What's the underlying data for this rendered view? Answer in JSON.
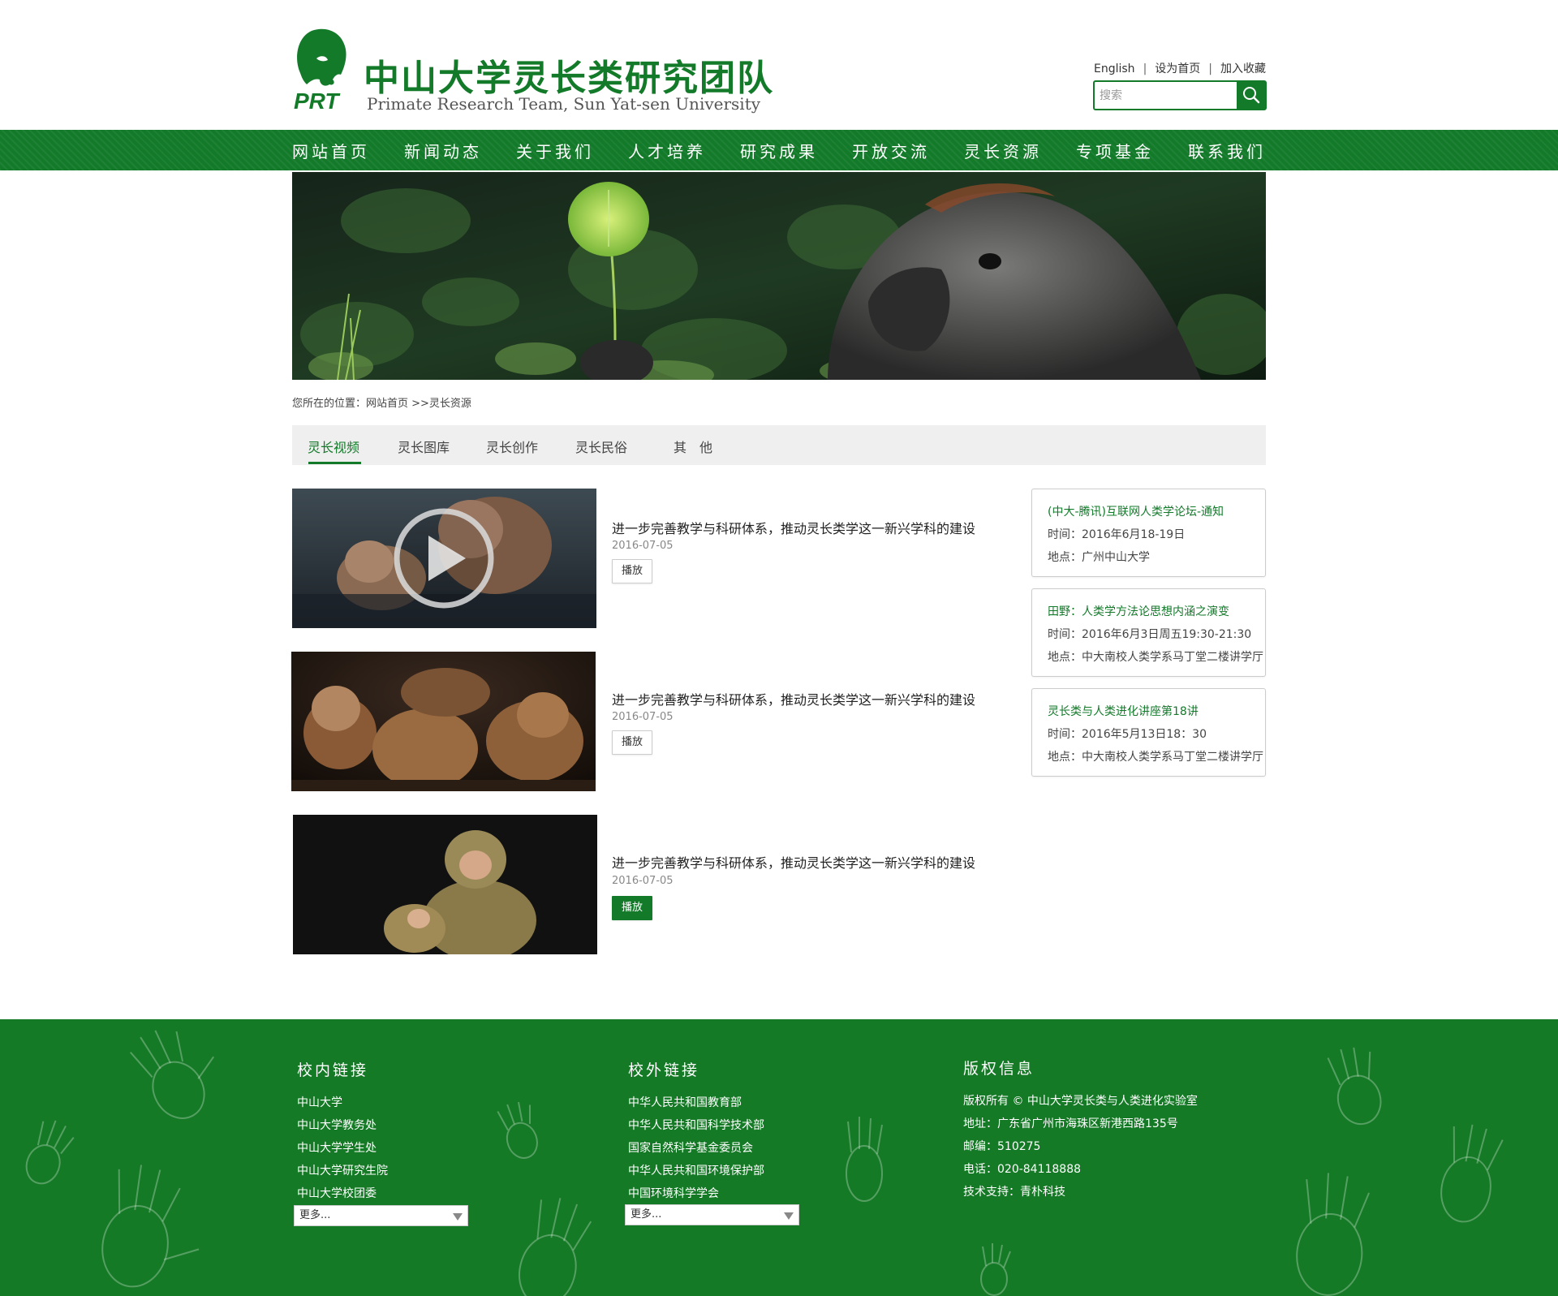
{
  "header": {
    "logo_mark_text": "PRT",
    "title": "中山大学灵长类研究团队",
    "subtitle": "Primate Research Team, Sun Yat-sen University",
    "links": [
      "English",
      "设为首页",
      "加入收藏"
    ],
    "link_separator": "|",
    "search_placeholder": "搜索"
  },
  "nav": {
    "items": [
      "网站首页",
      "新闻动态",
      "关于我们",
      "人才培养",
      "研究成果",
      "开放交流",
      "灵长资源",
      "专项基金",
      "联系我们"
    ]
  },
  "breadcrumb": {
    "text": "您所在的位置：网站首页 >>灵长资源"
  },
  "tabs": {
    "items": [
      "灵长视频",
      "灵长图库",
      "灵长创作",
      "灵长民俗",
      "其　他"
    ],
    "active_index": 0
  },
  "videos": [
    {
      "title": "进一步完善教学与科研体系，推动灵长类学这一新兴学科的建设",
      "date": "2016-07-05",
      "button": "播放",
      "button_active": false,
      "thumb_icon": "play-circle-icon"
    },
    {
      "title": "进一步完善教学与科研体系，推动灵长类学这一新兴学科的建设",
      "date": "2016-07-05",
      "button": "播放",
      "button_active": false
    },
    {
      "title": "进一步完善教学与科研体系，推动灵长类学这一新兴学科的建设",
      "date": "2016-07-05",
      "button": "播放",
      "button_active": true
    }
  ],
  "events": [
    {
      "title": "(中大-腾讯)互联网人类学论坛-通知",
      "time": "时间：2016年6月18-19日",
      "place": "地点：广州中山大学"
    },
    {
      "title": "田野：人类学方法论思想内涵之演变",
      "time": "时间：2016年6月3日周五19:30-21:30",
      "place": "地点：中大南校人类学系马丁堂二楼讲学厅"
    },
    {
      "title": "灵长类与人类进化讲座第18讲",
      "time": "时间：2016年5月13日18：30",
      "place": "地点：中大南校人类学系马丁堂二楼讲学厅"
    }
  ],
  "footer": {
    "internal": {
      "heading": "校内链接",
      "links": [
        "中山大学",
        "中山大学教务处",
        "中山大学学生处",
        "中山大学研究生院",
        "中山大学校团委"
      ],
      "select": "更多..."
    },
    "external": {
      "heading": "校外链接",
      "links": [
        "中华人民共和国教育部",
        "中华人民共和国科学技术部",
        "国家自然科学基金委员会",
        "中华人民共和国环境保护部",
        "中国环境科学学会"
      ],
      "select": "更多..."
    },
    "copyright": {
      "heading": "版权信息",
      "lines": [
        "版权所有 © 中山大学灵长类与人类进化实验室",
        "地址：广东省广州市海珠区新港西路135号",
        "邮编：510275",
        "电话：020-84118888",
        "技术支持：青朴科技"
      ]
    }
  },
  "colors": {
    "brand_green": "#137a2a",
    "footer_green": "#157a26",
    "tab_bg": "#efefef"
  }
}
